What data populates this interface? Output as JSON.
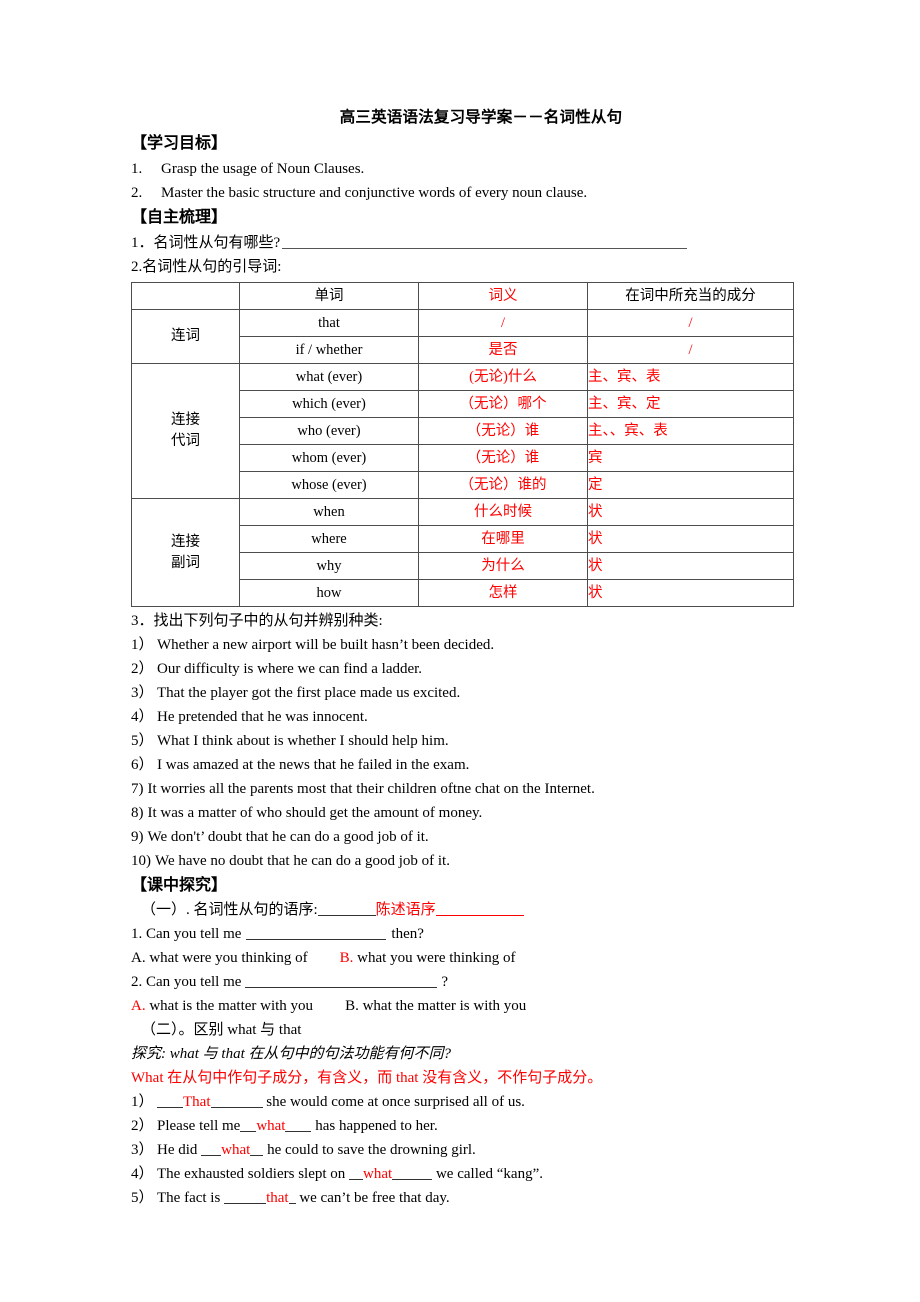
{
  "document": {
    "title": "高三英语语法复习导学案－－名词性从句"
  },
  "objectives": {
    "heading": "【学习目标】",
    "items": [
      {
        "num": "1.",
        "text": "Grasp the usage of Noun Clauses."
      },
      {
        "num": "2.",
        "text": "Master the basic structure and conjunctive words of every noun clause."
      }
    ]
  },
  "review": {
    "heading": "【自主梳理】",
    "q1": "1．名词性从句有哪些?",
    "q2": "2.名词性从句的引导词:"
  },
  "table": {
    "headers": [
      "",
      "单词",
      "词义",
      "在词中所充当的成分"
    ],
    "groups": [
      {
        "label": "连词",
        "rows": [
          {
            "word": "that",
            "meaning": "/",
            "role": "/",
            "role_center": true
          },
          {
            "word": "if / whether",
            "meaning": "是否",
            "role": "/",
            "role_center": true
          }
        ]
      },
      {
        "label": "连接\n代词",
        "label_line1": "连接",
        "label_line2": "代词",
        "rows": [
          {
            "word": "what (ever)",
            "meaning": "(无论)什么",
            "role": "主、宾、表",
            "role_center": false
          },
          {
            "word": "which (ever)",
            "meaning": "（无论）哪个",
            "role": "主、宾、定",
            "role_center": false
          },
          {
            "word": "who (ever)",
            "meaning": "（无论）谁",
            "role": "主、、宾、表",
            "role_center": false
          },
          {
            "word": "whom (ever)",
            "meaning": "（无论）谁",
            "role": "宾",
            "role_center": false
          },
          {
            "word": "whose (ever)",
            "meaning": "（无论）谁的",
            "role": "定",
            "role_center": false
          }
        ]
      },
      {
        "label_line1": "连接",
        "label_line2": "副词",
        "rows": [
          {
            "word": "when",
            "meaning": "什么时候",
            "role": "状",
            "role_center": false
          },
          {
            "word": "where",
            "meaning": "在哪里",
            "role": "状",
            "role_center": false
          },
          {
            "word": "why",
            "meaning": "为什么",
            "role": "状",
            "role_center": false
          },
          {
            "word": "how",
            "meaning": "怎样",
            "role": "状",
            "role_center": false
          }
        ]
      }
    ]
  },
  "exercise3": {
    "prompt": "3．找出下列句子中的从句并辨别种类:",
    "items": [
      {
        "num": "1）",
        "text": "Whether a new airport will be built hasn’t been decided."
      },
      {
        "num": "2）",
        "text": "Our difficulty is where we can find a ladder."
      },
      {
        "num": "3）",
        "text": "That the player got the first place made us excited."
      },
      {
        "num": "4）",
        "text": "He pretended that he was innocent."
      },
      {
        "num": "5）",
        "text": "What I think about is whether I should help him."
      },
      {
        "num": "6）",
        "text": "I was amazed at the news that he failed in the exam."
      },
      {
        "num": "7)",
        "text": "It worries all the parents most that their children oftne chat on the Internet."
      },
      {
        "num": "8)",
        "text": "It was a matter of who should get the amount of money."
      },
      {
        "num": "9)",
        "text": "We don't’ doubt that he can do a good job of it."
      },
      {
        "num": "10)",
        "text": "We have no doubt that he can do a good job of it."
      }
    ]
  },
  "inquiry": {
    "heading": "【课中探究】",
    "part1_label": "（一）. 名词性从句的语序:",
    "part1_answer": "陈述语序",
    "q1_prefix": "1. Can you tell me",
    "q1_suffix": "then?",
    "q1_optA_letter": "A.",
    "q1_optA_text": "what were you thinking of",
    "q1_optB_letter": "B.",
    "q1_optB_text": "what you were thinking of",
    "q1_correct": "B",
    "q2_prefix": "2. Can you tell me",
    "q2_suffix": "?",
    "q2_optA_letter": "A.",
    "q2_optA_text": "what is the matter with you",
    "q2_optB_letter": "B.",
    "q2_optB_text": "what the matter is with you",
    "q2_correct": "A",
    "part2_label": "（二）。区别 what 与 that",
    "explore_prefix": "探究:",
    "explore_text": "what 与 that 在从句中的句法功能有何不同?",
    "explanation": "What 在从句中作句子成分，有含义，而 that 没有含义，不作句子成分。",
    "fill_items": [
      {
        "num": "1）",
        "before": "",
        "answer": "That",
        "after": "she would come at once surprised all of us."
      },
      {
        "num": "2）",
        "before": "Please tell me",
        "answer": "what",
        "after": "has happened to her."
      },
      {
        "num": "3）",
        "before": "He did",
        "answer": "what",
        "after": "he could to save the drowning girl."
      },
      {
        "num": "4）",
        "before": "The exhausted soldiers slept on",
        "answer": "what",
        "after": "we called “kang”."
      },
      {
        "num": "5）",
        "before": "The fact is",
        "answer": "that",
        "after": "we can’t be free that day."
      }
    ]
  },
  "colors": {
    "accent_red": "#ff0000",
    "text": "#000000",
    "rule": "#4d4d4d"
  }
}
